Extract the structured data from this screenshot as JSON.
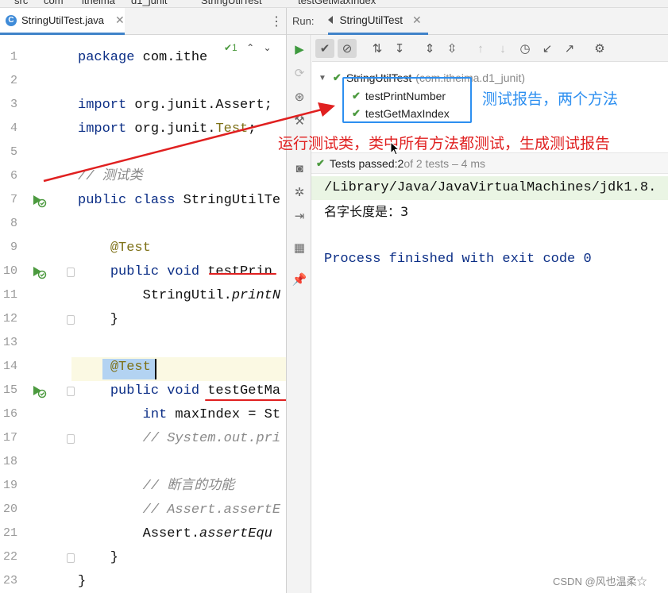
{
  "breadcrumb": [
    "src",
    "com",
    "itheima",
    "d1_junit",
    "StringUtilTest",
    "testGetMaxIndex"
  ],
  "editor": {
    "tab_label": "StringUtilTest.java",
    "tab_icon": "C",
    "inspection": "✔1",
    "line_numbers": [
      "1",
      "2",
      "3",
      "4",
      "5",
      "6",
      "7",
      "8",
      "9",
      "10",
      "11",
      "12",
      "13",
      "14",
      "15",
      "16",
      "17",
      "18",
      "19",
      "20",
      "21",
      "22",
      "23"
    ],
    "lines": [
      {
        "parts": [
          {
            "t": "package",
            "c": "kw"
          },
          {
            "t": " com.ithe"
          }
        ]
      },
      {
        "parts": []
      },
      {
        "parts": [
          {
            "t": "import",
            "c": "kw"
          },
          {
            "t": " org.junit.Assert;"
          }
        ]
      },
      {
        "parts": [
          {
            "t": "import",
            "c": "kw"
          },
          {
            "t": " org.junit."
          },
          {
            "t": "Test",
            "c": "ann"
          },
          {
            "t": ";"
          }
        ]
      },
      {
        "parts": []
      },
      {
        "parts": [
          {
            "t": "// 测试类",
            "c": "cmt"
          }
        ]
      },
      {
        "parts": [
          {
            "t": "public class",
            "c": "kw"
          },
          {
            "t": " StringUtilTe"
          }
        ]
      },
      {
        "parts": []
      },
      {
        "parts": [
          {
            "t": "    "
          },
          {
            "t": "@Test",
            "c": "ann"
          }
        ]
      },
      {
        "parts": [
          {
            "t": "    "
          },
          {
            "t": "public void",
            "c": "kw"
          },
          {
            "t": " testPrin"
          }
        ]
      },
      {
        "parts": [
          {
            "t": "        StringUtil."
          },
          {
            "t": "printN",
            "c": "it"
          }
        ]
      },
      {
        "parts": [
          {
            "t": "    }"
          }
        ]
      },
      {
        "parts": []
      },
      {
        "parts": [
          {
            "t": "    "
          },
          {
            "t": "@Test",
            "c": "ann"
          }
        ]
      },
      {
        "parts": [
          {
            "t": "    "
          },
          {
            "t": "public void",
            "c": "kw"
          },
          {
            "t": " testGetMa"
          }
        ]
      },
      {
        "parts": [
          {
            "t": "        "
          },
          {
            "t": "int",
            "c": "kw"
          },
          {
            "t": " maxIndex = St"
          }
        ]
      },
      {
        "parts": [
          {
            "t": "        "
          },
          {
            "t": "// System.out.pri",
            "c": "cmt"
          }
        ]
      },
      {
        "parts": []
      },
      {
        "parts": [
          {
            "t": "        "
          },
          {
            "t": "// 断言的功能",
            "c": "cmt"
          }
        ]
      },
      {
        "parts": [
          {
            "t": "        "
          },
          {
            "t": "// Assert.assertE",
            "c": "cmt"
          }
        ]
      },
      {
        "parts": [
          {
            "t": "        Assert."
          },
          {
            "t": "assertEqu",
            "c": "it"
          }
        ]
      },
      {
        "parts": [
          {
            "t": "    }"
          }
        ]
      },
      {
        "parts": [
          {
            "t": "}"
          }
        ]
      }
    ]
  },
  "run": {
    "label": "Run:",
    "tab_label": "StringUtilTest",
    "tree": {
      "root_label": "StringUtilTest",
      "root_pkg": "(com.itheima.d1_junit)",
      "children": [
        "testPrintNumber",
        "testGetMaxIndex"
      ]
    },
    "status": {
      "prefix": "Tests passed: ",
      "count": "2",
      "suffix": " of 2 tests – 4 ms"
    },
    "console": {
      "path": "/Library/Java/JavaVirtualMachines/jdk1.8.",
      "output": "名字长度是：3",
      "exit": "Process finished with exit code 0"
    }
  },
  "annotations": {
    "box_note": "测试报告，两个方法",
    "arrow_note": "运行测试类，类中所有方法都测试，生成测试报告"
  },
  "watermark": "CSDN @风也温柔☆",
  "colors": {
    "accent_blue": "#2d8ff0",
    "annotation_red": "#e02020",
    "pass_green": "#4c9a3f"
  }
}
